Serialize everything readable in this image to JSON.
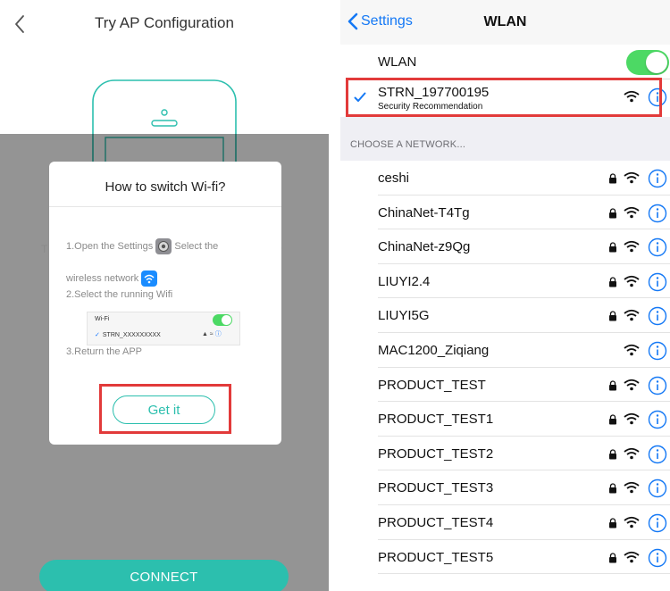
{
  "left_panel": {
    "title": "Try AP Configuration",
    "background_text_left": "T",
    "background_text_right": "-",
    "dialog": {
      "title": "How to switch Wi-fi?",
      "step1_part1": "1.Open the Settings",
      "step1_part2": "Select the",
      "step1_part3": "wireless network",
      "step2": "2.Select the running Wifi",
      "step3": "3.Return the APP",
      "mini_card": {
        "label": "Wi-Fi",
        "network": "STRN_XXXXXXXXX"
      },
      "get_it_label": "Get it"
    },
    "connect_label": "CONNECT"
  },
  "right_panel": {
    "nav": {
      "back_label": "Settings",
      "title": "WLAN"
    },
    "wlan_label": "WLAN",
    "wlan_enabled": true,
    "connected": {
      "name": "STRN_197700195",
      "subtitle": "Security Recommendation"
    },
    "section_header": "CHOOSE A NETWORK...",
    "networks": [
      {
        "name": "ceshi",
        "locked": true
      },
      {
        "name": "ChinaNet-T4Tg",
        "locked": true
      },
      {
        "name": "ChinaNet-z9Qg",
        "locked": true
      },
      {
        "name": "LIUYI2.4",
        "locked": true
      },
      {
        "name": "LIUYI5G",
        "locked": true
      },
      {
        "name": "MAC1200_Ziqiang",
        "locked": false
      },
      {
        "name": "PRODUCT_TEST",
        "locked": true
      },
      {
        "name": "PRODUCT_TEST1",
        "locked": true
      },
      {
        "name": "PRODUCT_TEST2",
        "locked": true
      },
      {
        "name": "PRODUCT_TEST3",
        "locked": true
      },
      {
        "name": "PRODUCT_TEST4",
        "locked": true
      },
      {
        "name": "PRODUCT_TEST5",
        "locked": true
      }
    ]
  },
  "colors": {
    "accent_teal": "#2cbfae",
    "ios_blue": "#1478f5",
    "toggle_green": "#4cd964",
    "highlight_red": "#e23a3a"
  }
}
